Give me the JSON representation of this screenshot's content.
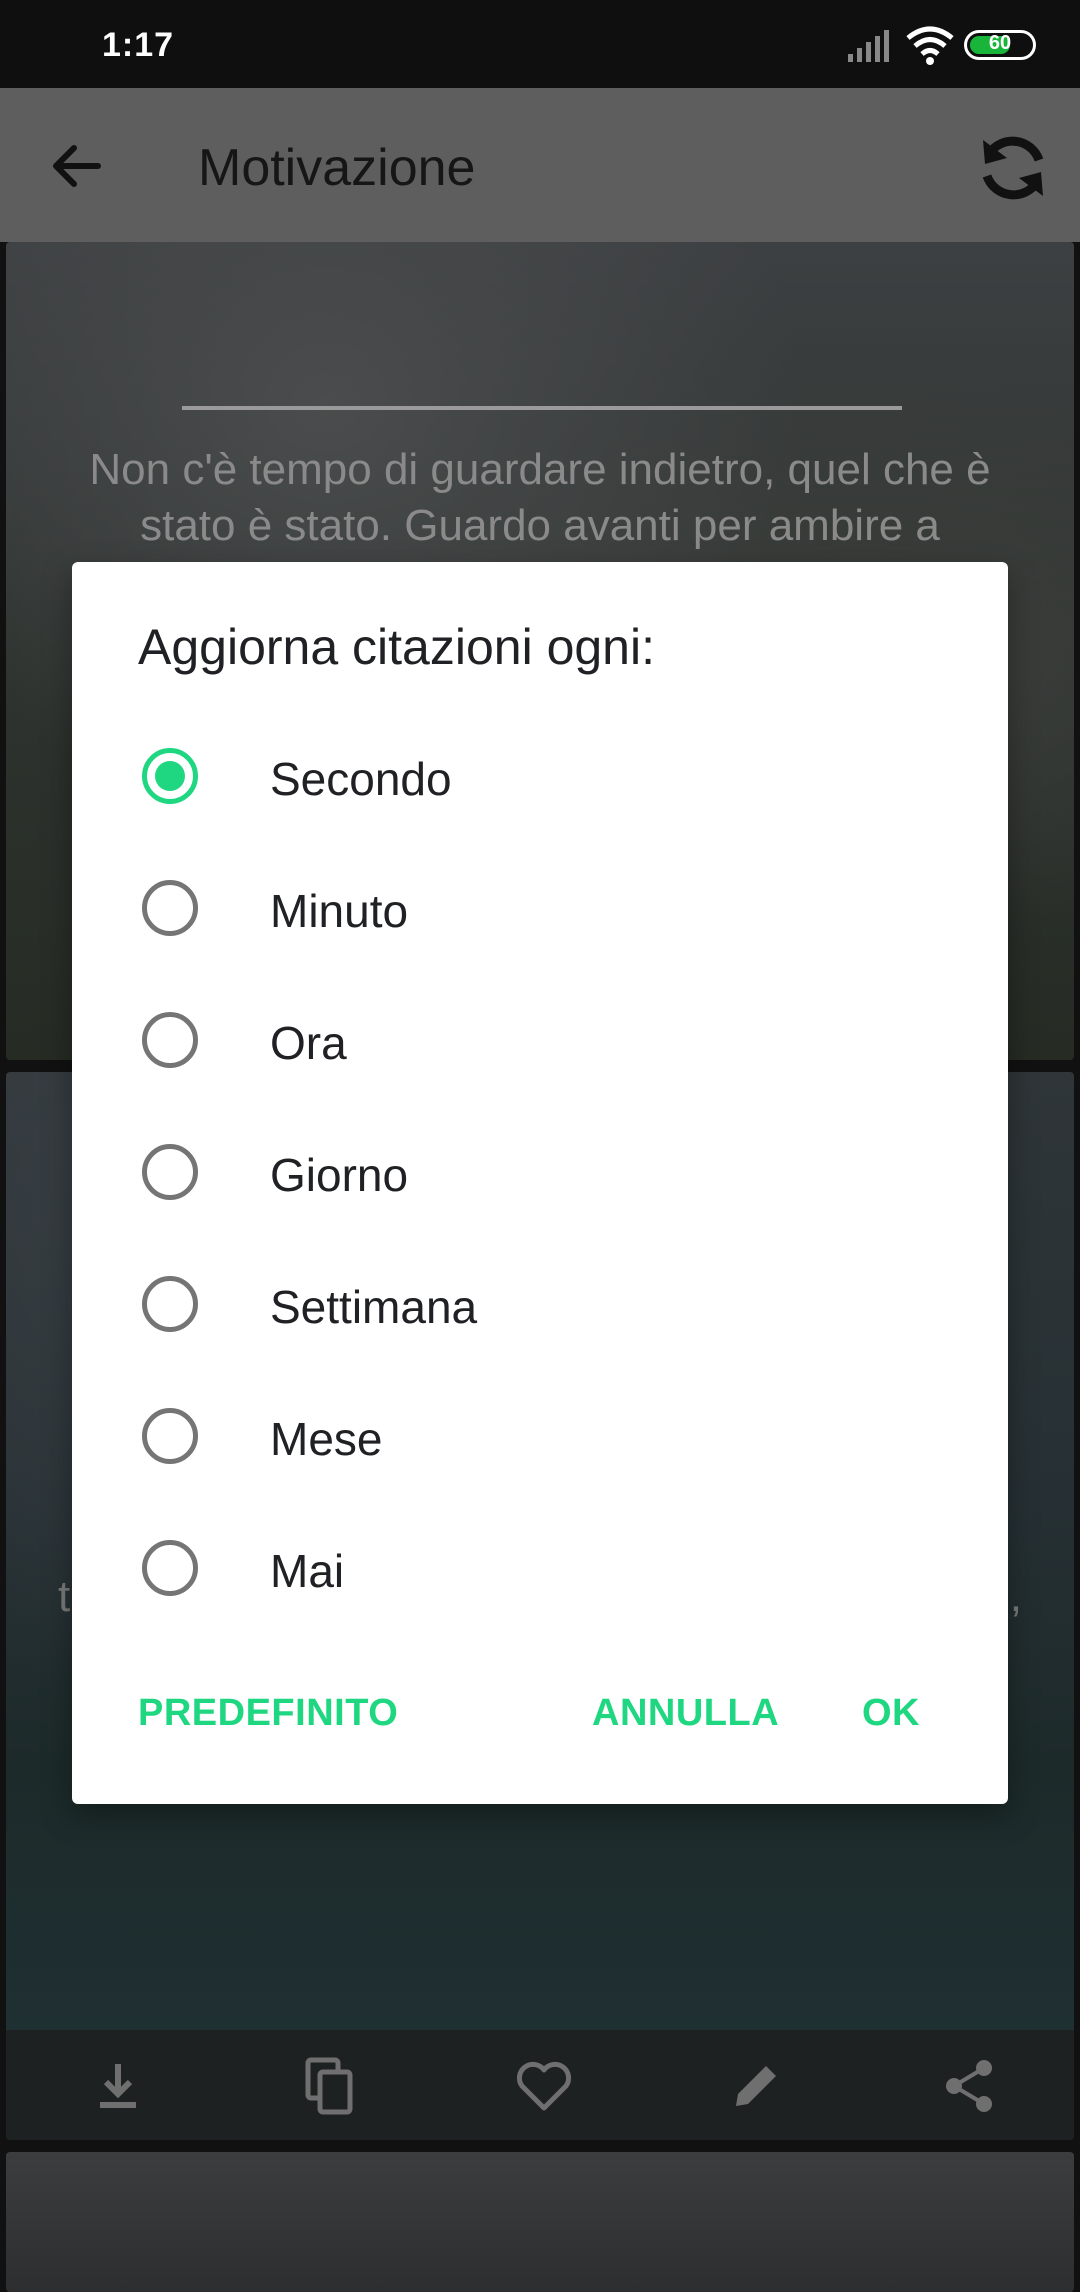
{
  "status_bar": {
    "time": "1:17",
    "battery": "60",
    "battery_color": "#19b53b",
    "icons": [
      "signal-icon",
      "wifi-icon",
      "battery-icon"
    ]
  },
  "app_bar": {
    "title": "Motivazione",
    "icons": [
      "back-arrow-icon",
      "refresh-icon"
    ]
  },
  "background": {
    "card1_quote": "Non c'è tempo di guardare indietro, quel che è stato è stato. Guardo avanti per ambire a",
    "card2_left_fragment": "t",
    "card2_right_fragment": "e,",
    "action_icons": [
      "download-icon",
      "copy-icon",
      "heart-icon",
      "edit-icon",
      "share-icon"
    ]
  },
  "dialog": {
    "title": "Aggiorna citazioni ogni:",
    "accent_color": "#1fd781",
    "selected_index": 0,
    "options": [
      {
        "label": "Secondo"
      },
      {
        "label": "Minuto"
      },
      {
        "label": "Ora"
      },
      {
        "label": "Giorno"
      },
      {
        "label": "Settimana"
      },
      {
        "label": "Mese"
      },
      {
        "label": "Mai"
      }
    ],
    "buttons": {
      "default": "PREDEFINITO",
      "cancel": "ANNULLA",
      "ok": "OK"
    }
  }
}
